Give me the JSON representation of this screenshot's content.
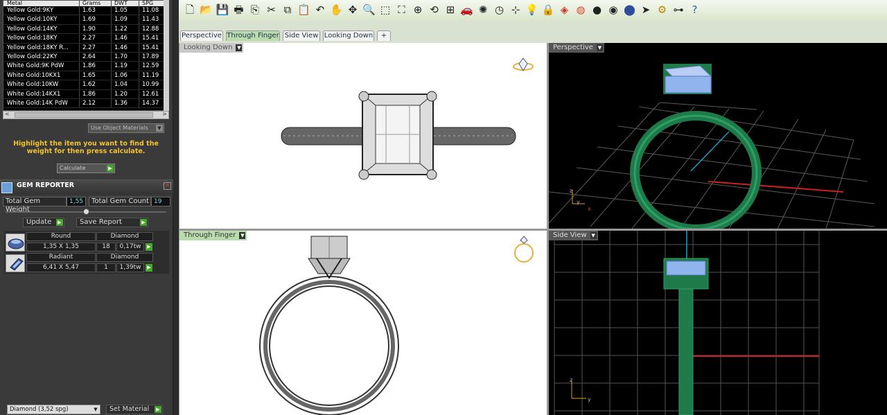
{
  "metal_table": {
    "columns": [
      "Metal",
      "Grams",
      "DWT",
      "SPG"
    ],
    "rows": [
      [
        "Yellow Gold:9KY",
        "1.63",
        "1.05",
        "11.08"
      ],
      [
        "Yellow Gold:10KY",
        "1.69",
        "1.09",
        "11.43"
      ],
      [
        "Yellow Gold:14KY",
        "1.90",
        "1.22",
        "12.88"
      ],
      [
        "Yellow Gold:18KY",
        "2.27",
        "1.46",
        "15.41"
      ],
      [
        "Yellow Gold:18KY R...",
        "2.27",
        "1.46",
        "15.41"
      ],
      [
        "Yellow Gold:22KY",
        "2.64",
        "1.70",
        "17.89"
      ],
      [
        "White Gold:9K PdW",
        "1.86",
        "1.19",
        "12.59"
      ],
      [
        "White Gold:10KX1",
        "1.65",
        "1.06",
        "11.19"
      ],
      [
        "White Gold:10KW",
        "1.62",
        "1.04",
        "10.99"
      ],
      [
        "White Gold:14KX1",
        "1.86",
        "1.20",
        "12.61"
      ],
      [
        "White Gold:14K PdW",
        "2.12",
        "1.36",
        "14.37"
      ]
    ]
  },
  "metal_panel": {
    "use_object_materials": "Use Object Materials",
    "instruction": "Highlight the item you want to find the weight for then press calculate.",
    "calculate_label": "Calculate"
  },
  "gem_reporter": {
    "title": "GEM REPORTER",
    "total_weight_label": "Total Gem Weight",
    "total_weight_value": "1,55",
    "total_count_label": "Total Gem Count",
    "total_count_value": "19",
    "update_label": "Update",
    "save_report_label": "Save Report",
    "gems": [
      {
        "shape": "Round",
        "type": "Diamond",
        "size": "1,35 X 1,35",
        "count": "18",
        "weight": "0,17tw"
      },
      {
        "shape": "Radiant",
        "type": "Diamond",
        "size": "6,41 X 5,47",
        "count": "1",
        "weight": "1,39tw"
      }
    ],
    "material_select": "Diamond    (3,52 spg)",
    "set_material_label": "Set Material"
  },
  "tabs": [
    {
      "label": "Perspective"
    },
    {
      "label": "Through Finger"
    },
    {
      "label": "Side View"
    },
    {
      "label": "Looking Down"
    },
    {
      "label": "+"
    }
  ],
  "viewports": {
    "top_left": "Looking Down",
    "top_right": "Perspective",
    "bottom_left": "Through Finger",
    "bottom_right": "Side View"
  },
  "axes": {
    "x": "x",
    "y": "y",
    "z": "z"
  },
  "icons": [
    "new-file-icon",
    "open-folder-icon",
    "save-icon",
    "print-icon",
    "copy-icon",
    "cut-icon",
    "paste-copy-icon",
    "paste-icon",
    "undo-icon",
    "pan-hand-icon",
    "move-icon",
    "zoom-icon",
    "zoom-window-icon",
    "zoom-extents-icon",
    "zoom-selected-icon",
    "rotate-view-icon",
    "four-viewports-icon",
    "car-icon",
    "orbit-icon",
    "clock-icon",
    "grid-snap-icon",
    "light-bulb-icon",
    "lock-icon",
    "render-icon",
    "color-wheel-icon",
    "shaded-ball-icon",
    "metal-ball-icon",
    "blue-ball-icon",
    "select-pointer-icon",
    "settings-gear-icon",
    "hierarchy-icon",
    "help-icon"
  ],
  "colors": {
    "accent_green": "#4aa52e",
    "instruction_text": "#f2c230",
    "ring_green": "#1f7a4a",
    "gem_blue": "#8fb4ee"
  }
}
